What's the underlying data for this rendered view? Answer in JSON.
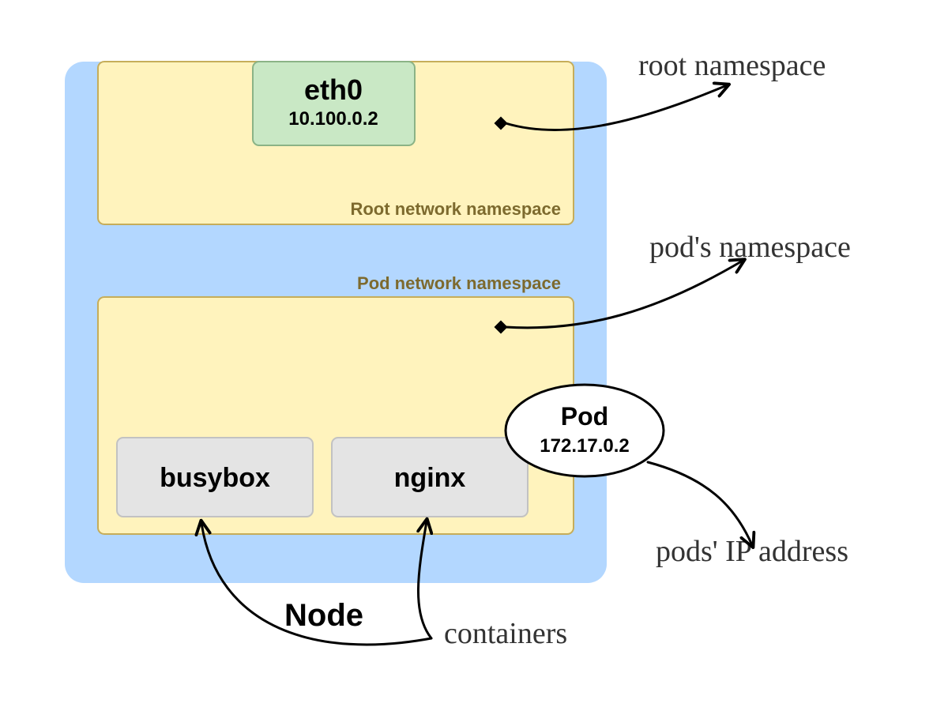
{
  "node": {
    "label": "Node"
  },
  "root_ns": {
    "caption": "Root network namespace",
    "interface": {
      "name": "eth0",
      "ip": "10.100.0.2"
    }
  },
  "pod_ns": {
    "caption": "Pod network namespace",
    "pod": {
      "label": "Pod",
      "ip": "172.17.0.2"
    },
    "containers": [
      {
        "name": "busybox"
      },
      {
        "name": "nginx"
      }
    ]
  },
  "annotations": {
    "root_ns": "root namespace",
    "pod_ns": "pod's namespace",
    "pod_ip": "pods' IP address",
    "containers": "containers"
  },
  "colors": {
    "node_bg": "#b3d7ff",
    "namespace_bg": "#fff3bd",
    "interface_bg": "#c9e8c5",
    "container_bg": "#e4e4e4"
  }
}
